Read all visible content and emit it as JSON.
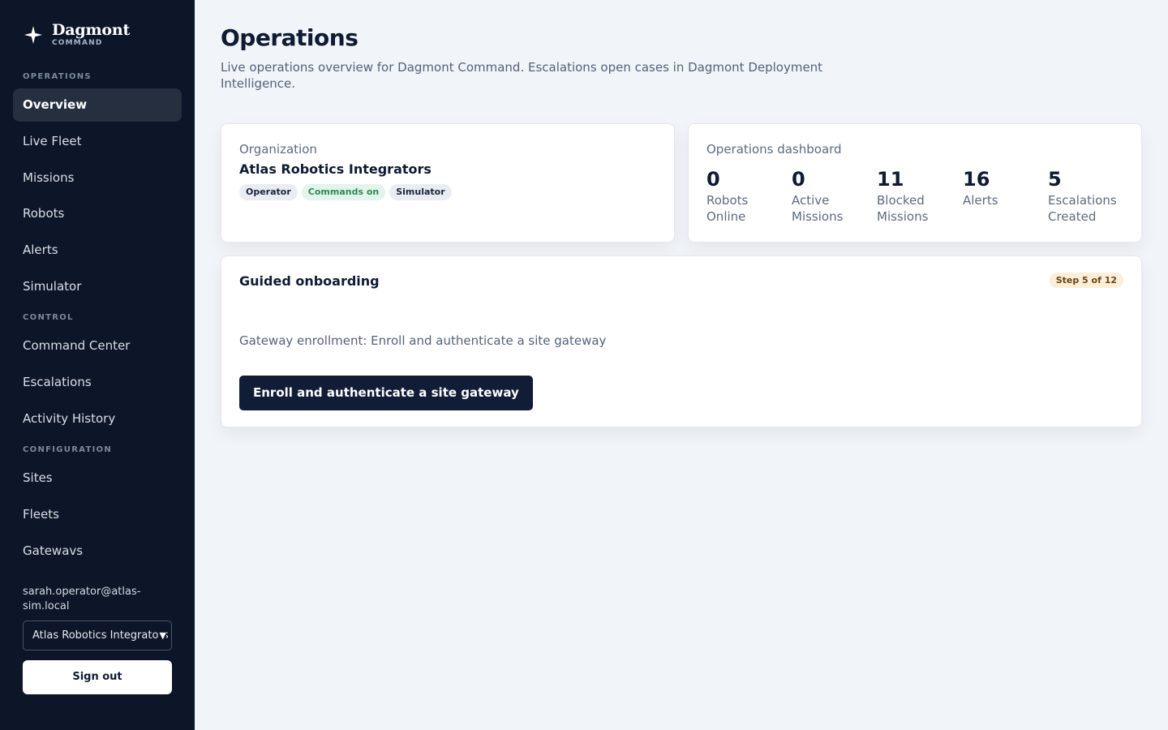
{
  "brand": {
    "name": "Dagmont",
    "subtitle": "COMMAND"
  },
  "nav": {
    "sections": [
      {
        "title": "OPERATIONS",
        "items": [
          "Overview",
          "Live Fleet",
          "Missions",
          "Robots",
          "Alerts",
          "Simulator"
        ]
      },
      {
        "title": "CONTROL",
        "items": [
          "Command Center",
          "Escalations",
          "Activity History"
        ]
      },
      {
        "title": "CONFIGURATION",
        "items": [
          "Sites",
          "Fleets",
          "Gatewavs"
        ]
      }
    ],
    "active": "Overview"
  },
  "user": {
    "email": "sarah.operator@atlas-sim.local",
    "org_select": "Atlas Robotics Integrators",
    "signout_label": "Sign out"
  },
  "page": {
    "title": "Operations",
    "subtitle": "Live operations overview for Dagmont Command. Escalations open cases in Dagmont Deployment Intelligence."
  },
  "org_card": {
    "label": "Organization",
    "name": "Atlas Robotics Integrators",
    "tags": [
      "Operator",
      "Commands on",
      "Simulator"
    ]
  },
  "dashboard": {
    "label": "Operations dashboard",
    "stats": [
      {
        "value": "0",
        "label": "Robots Online"
      },
      {
        "value": "0",
        "label": "Active Missions"
      },
      {
        "value": "11",
        "label": "Blocked Missions"
      },
      {
        "value": "16",
        "label": "Alerts"
      },
      {
        "value": "5",
        "label": "Escalations Created"
      }
    ]
  },
  "onboarding": {
    "title": "Guided onboarding",
    "step": "Step 5 of 12",
    "description": "Gateway enrollment: Enroll and authenticate a site gateway",
    "button_label": "Enroll and authenticate a site gateway"
  },
  "colors": {
    "sidebar_bg": "#0d1628",
    "accent": "#111c36",
    "tag_green": "#2f8a54",
    "step_badge": "#fbefd9"
  }
}
